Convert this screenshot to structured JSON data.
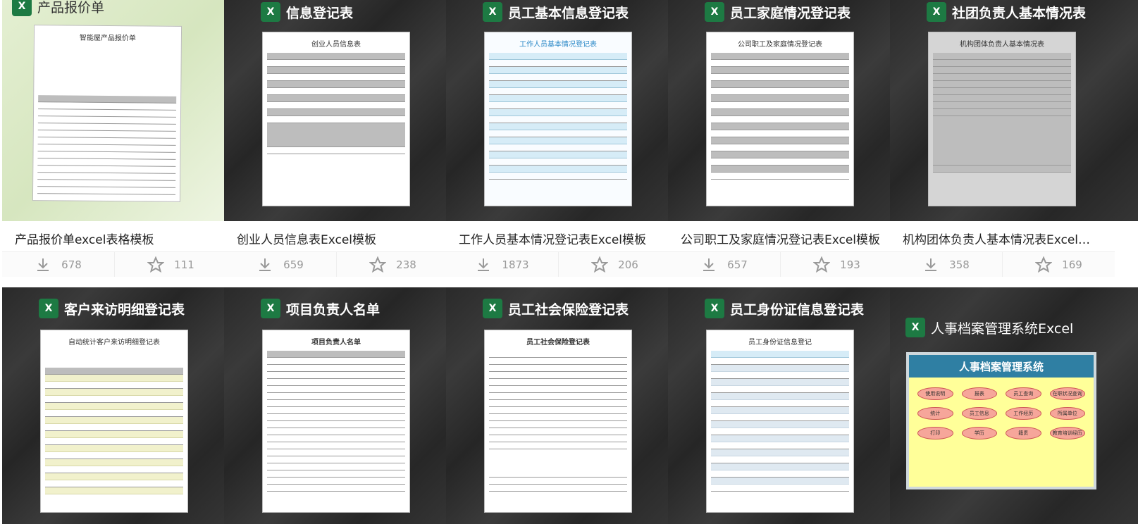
{
  "colors": {
    "excel_green": "#1d7a43",
    "card_dark": "#2a2a2a",
    "stat_gray": "#999999"
  },
  "icons": {
    "excel": "excel-icon",
    "download": "download-icon",
    "star": "star-icon"
  },
  "cards": [
    {
      "thumb_title": "产品报价单",
      "doc_title": "智能屋产品报价单",
      "caption": "产品报价单excel表格模板",
      "downloads": "678",
      "stars": "111"
    },
    {
      "thumb_title": "信息登记表",
      "doc_title": "创业人员信息表",
      "caption": "创业人员信息表Excel模板",
      "downloads": "659",
      "stars": "238"
    },
    {
      "thumb_title": "员工基本信息登记表",
      "doc_title": "工作人员基本情况登记表",
      "caption": "工作人员基本情况登记表Excel模板",
      "downloads": "1873",
      "stars": "206"
    },
    {
      "thumb_title": "员工家庭情况登记表",
      "doc_title": "公司职工及家庭情况登记表",
      "caption": "公司职工及家庭情况登记表Excel模板",
      "downloads": "657",
      "stars": "193"
    },
    {
      "thumb_title": "社团负责人基本情况表",
      "doc_title": "机构团体负责人基本情况表",
      "caption": "机构团体负责人基本情况表Excel模板",
      "downloads": "358",
      "stars": "169"
    },
    {
      "thumb_title": "客户来访明细登记表",
      "doc_title": "自动统计客户来访明细登记表"
    },
    {
      "thumb_title": "项目负责人名单",
      "doc_title": "项目负责人名单"
    },
    {
      "thumb_title": "员工社会保险登记表",
      "doc_title": "员工社会保险登记表"
    },
    {
      "thumb_title": "员工身份证信息登记表",
      "doc_title": "员工身份证信息登记"
    },
    {
      "thumb_title": "人事档案管理系统Excel",
      "doc_title": "人事档案管理系统",
      "buttons": [
        "使用说明",
        "报表",
        "员工查询",
        "在职状况查询",
        "统计",
        "员工信息",
        "工作经历",
        "所属单位",
        "打印",
        "学历",
        "籍贯",
        "教育培训经历"
      ]
    }
  ]
}
